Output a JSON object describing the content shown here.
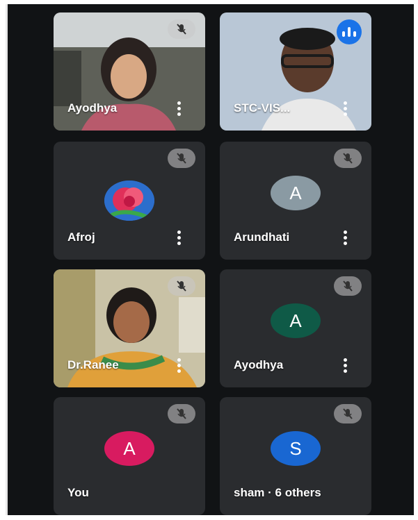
{
  "participants": [
    {
      "name": "Ayodhya",
      "mic": "muted-icon",
      "video": true
    },
    {
      "name": "STC-VIS...",
      "mic": "speaking-icon",
      "video": true
    },
    {
      "name": "Afroj",
      "mic": "muted-icon",
      "avatar_type": "flower-image"
    },
    {
      "name": "Arundhati",
      "mic": "muted-icon",
      "avatar_letter": "A",
      "avatar_color": "#8a9aa3"
    },
    {
      "name": "Dr.Ranee",
      "mic": "muted-icon",
      "video": true
    },
    {
      "name": "Ayodhya",
      "mic": "muted-icon",
      "avatar_letter": "A",
      "avatar_color": "#0f5a47"
    },
    {
      "name": "You",
      "mic": "muted-icon",
      "avatar_letter": "A",
      "avatar_color": "#d81b60"
    },
    {
      "name": "sham · 6 others",
      "mic": "muted-icon",
      "avatar_letter": "S",
      "avatar_color": "#1967d2"
    }
  ]
}
